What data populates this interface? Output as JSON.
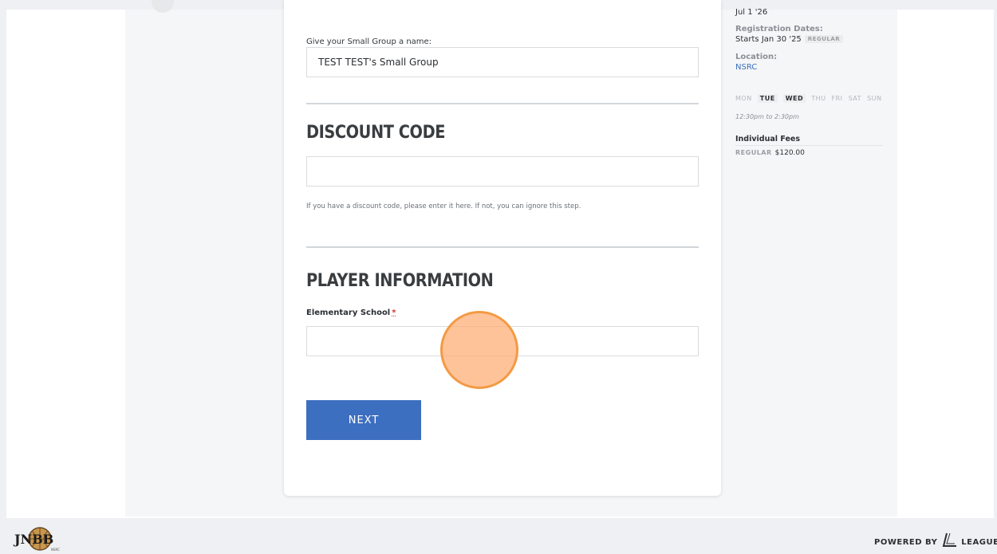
{
  "form": {
    "group_name_label": "Give your Small Group a name:",
    "group_name_value": "TEST TEST's Small Group",
    "discount_heading": "DISCOUNT CODE",
    "discount_value": "",
    "discount_hint": "If you have a discount code, please enter it here. If not, you can ignore this step.",
    "player_heading": "PLAYER INFORMATION",
    "school_label": "Elementary School",
    "required_marker": "*",
    "school_value": "",
    "next_label": "NEXT"
  },
  "sidebar": {
    "end_date": "Jul 1 '26",
    "registration_label": "Registration Dates:",
    "registration_value": "Starts Jan 30 '25",
    "registration_badge": "REGULAR",
    "location_label": "Location:",
    "location_value": "NSRC",
    "days": [
      "MON",
      "TUE",
      "WED",
      "THU",
      "FRI",
      "SAT",
      "SUN"
    ],
    "active_days": [
      "TUE",
      "WED"
    ],
    "time": "12:30pm to 2:30pm",
    "fees_title": "Individual Fees",
    "fee_tag": "REGULAR",
    "fee_amount": "$120.00"
  },
  "footer": {
    "logo_text": "JNBB",
    "logo_sub": "NSRC",
    "powered_by": "POWERED BY",
    "brand": "LEAGUEA"
  },
  "colors": {
    "accent": "#3d6fc0",
    "required": "#d0312d",
    "click_marker": "#f39a45"
  }
}
